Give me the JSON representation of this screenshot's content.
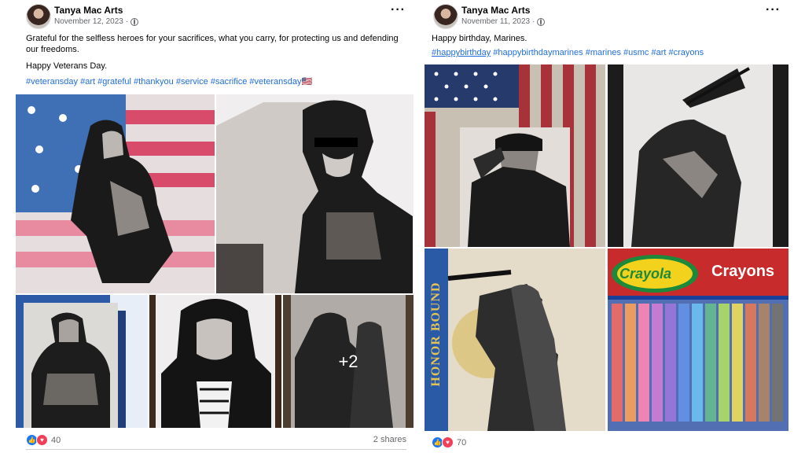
{
  "posts": [
    {
      "author": "Tanya Mac Arts",
      "date": "November 12, 2023",
      "more_icon": "ellipsis-icon",
      "privacy_icon": "globe-icon",
      "caption": "Grateful for the selfless heroes for your sacrifices, what you carry, for protecting us and defending our freedoms.",
      "caption2": "Happy Veterans Day.",
      "hashtags": [
        "#veteransday",
        "#art",
        "#grateful",
        "#thankyou",
        "#service",
        "#sacrifice",
        "#veteransday🇺🇸"
      ],
      "photos": [
        "soldier kneeling on flag painting",
        "soldier with sunglasses painting",
        "marine with flag painting",
        "portrait in hoodie painting",
        "soldiers painting"
      ],
      "more_photos": "+2",
      "reaction_count": "40",
      "shares": "2 shares"
    },
    {
      "author": "Tanya Mac Arts",
      "date": "November 11, 2023",
      "more_icon": "ellipsis-icon",
      "privacy_icon": "globe-icon",
      "caption": "Happy birthday, Marines.",
      "hashtags": [
        "#happybirthday",
        "#happybirthdaymarines",
        "#marines",
        "#usmc",
        "#art",
        "#crayons"
      ],
      "photos": [
        "saluting marine with flag",
        "flag raising painting",
        "honor bound painting",
        "crayola crayons box"
      ],
      "photo_text": {
        "crayola": "Crayola",
        "crayons": "Crayons",
        "honor": "HONOR BOUND"
      },
      "reaction_count": "70"
    }
  ],
  "colors": {
    "link": "#216fdb",
    "like": "#1877f2",
    "love": "#f33e58",
    "muted": "#65676b"
  }
}
